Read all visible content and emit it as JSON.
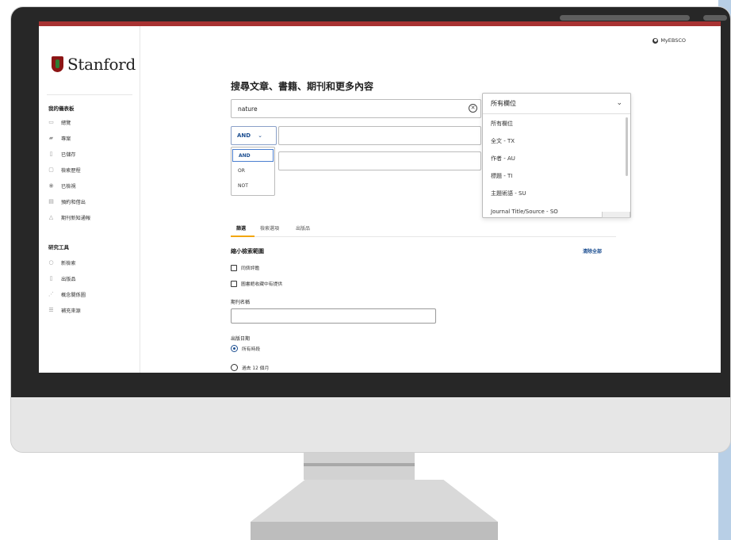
{
  "app": {
    "myebsco_label": "MyEBSCO",
    "logo_text": "Stanford"
  },
  "sidebar": {
    "dashboard_heading": "我的儀表板",
    "dashboard_items": [
      {
        "label": "總覽",
        "icon": "overview-icon"
      },
      {
        "label": "專案",
        "icon": "folder-icon"
      },
      {
        "label": "已儲存",
        "icon": "bookmark-icon"
      },
      {
        "label": "檢索歷程",
        "icon": "history-icon"
      },
      {
        "label": "已檢視",
        "icon": "eye-icon"
      },
      {
        "label": "預約和借出",
        "icon": "book-icon"
      },
      {
        "label": "期刊新知通報",
        "icon": "bell-icon"
      }
    ],
    "tools_heading": "研究工具",
    "tools_items": [
      {
        "label": "新檢索",
        "icon": "search-icon"
      },
      {
        "label": "出版品",
        "icon": "document-icon"
      },
      {
        "label": "概念關係圖",
        "icon": "concept-map-icon"
      },
      {
        "label": "補充來源",
        "icon": "sources-icon"
      }
    ]
  },
  "search": {
    "title": "搜尋文章、書籍、期刊和更多內容",
    "query_value": "nature",
    "operator_value": "AND",
    "operator_options": [
      "AND",
      "OR",
      "NOT"
    ],
    "field_selected": "所有欄位",
    "field_options": [
      "所有欄位",
      "全文 - TX",
      "作者 - AU",
      "標題 - TI",
      "主題術語 - SU",
      "Journal Title/Source - SO"
    ]
  },
  "tabs": [
    {
      "label": "篩選"
    },
    {
      "label": "檢索選項"
    },
    {
      "label": "出版品"
    }
  ],
  "filters": {
    "narrow_title": "縮小檢索範圍",
    "clear_all": "清除全部",
    "peer_reviewed": "同儕評鑑",
    "library_holdings": "圖書館收藏中有提供",
    "journal_name_label": "期刊名稱",
    "pub_date_label": "出版日期",
    "date_options": [
      {
        "label": "所有時段",
        "selected": true
      },
      {
        "label": "過去 12 個月",
        "selected": false
      }
    ]
  },
  "colors": {
    "brand_red": "#a83232",
    "accent_blue": "#1d4f91",
    "tab_underline": "#f2a60c"
  }
}
